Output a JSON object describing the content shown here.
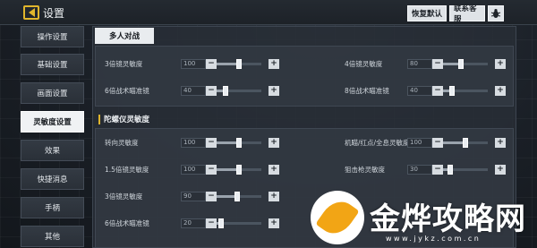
{
  "header": {
    "title": "设置",
    "restore_label": "恢复默认",
    "service_label": "联系客服",
    "bug_icon": "bug-icon"
  },
  "nav": {
    "items": [
      {
        "label": "操作设置"
      },
      {
        "label": "基础设置"
      },
      {
        "label": "画面设置"
      },
      {
        "label": "灵敏度设置"
      },
      {
        "label": "效果"
      },
      {
        "label": "快捷消息"
      },
      {
        "label": "手柄"
      },
      {
        "label": "其他"
      }
    ],
    "active_index": 3
  },
  "tabs": {
    "mode_label": "多人对战"
  },
  "scope_section": {
    "left": [
      {
        "label": "3倍镜灵敏度",
        "value": "100",
        "level": 0.5
      },
      {
        "label": "6倍战术瞄准镜",
        "value": "40",
        "level": 0.2
      }
    ],
    "right": [
      {
        "label": "4倍镜灵敏度",
        "value": "80",
        "level": 0.4
      },
      {
        "label": "8倍战术瞄准镜",
        "value": "40",
        "level": 0.2
      }
    ]
  },
  "gyro_section": {
    "title": "陀螺仪灵敏度",
    "left": [
      {
        "label": "转向灵敏度",
        "value": "100",
        "level": 0.5
      },
      {
        "label": "1.5倍镜灵敏度",
        "value": "100",
        "level": 0.5
      },
      {
        "label": "3倍镜灵敏度",
        "value": "90",
        "level": 0.45
      },
      {
        "label": "6倍战术瞄准镜",
        "value": "20",
        "level": 0.1
      }
    ],
    "right": [
      {
        "label": "机瞄/红点/全息灵敏度",
        "value": "100",
        "level": 0.5
      },
      {
        "label": "狙击枪灵敏度",
        "value": "30",
        "level": 0.15
      }
    ]
  },
  "watermark": {
    "brand": "金烨攻略网",
    "url": "www.jykz.com.cn"
  },
  "colors": {
    "accent": "#e0b52c",
    "active_nav_bg": "#f0f2f4",
    "watermark_leaf": "#f2a515"
  }
}
